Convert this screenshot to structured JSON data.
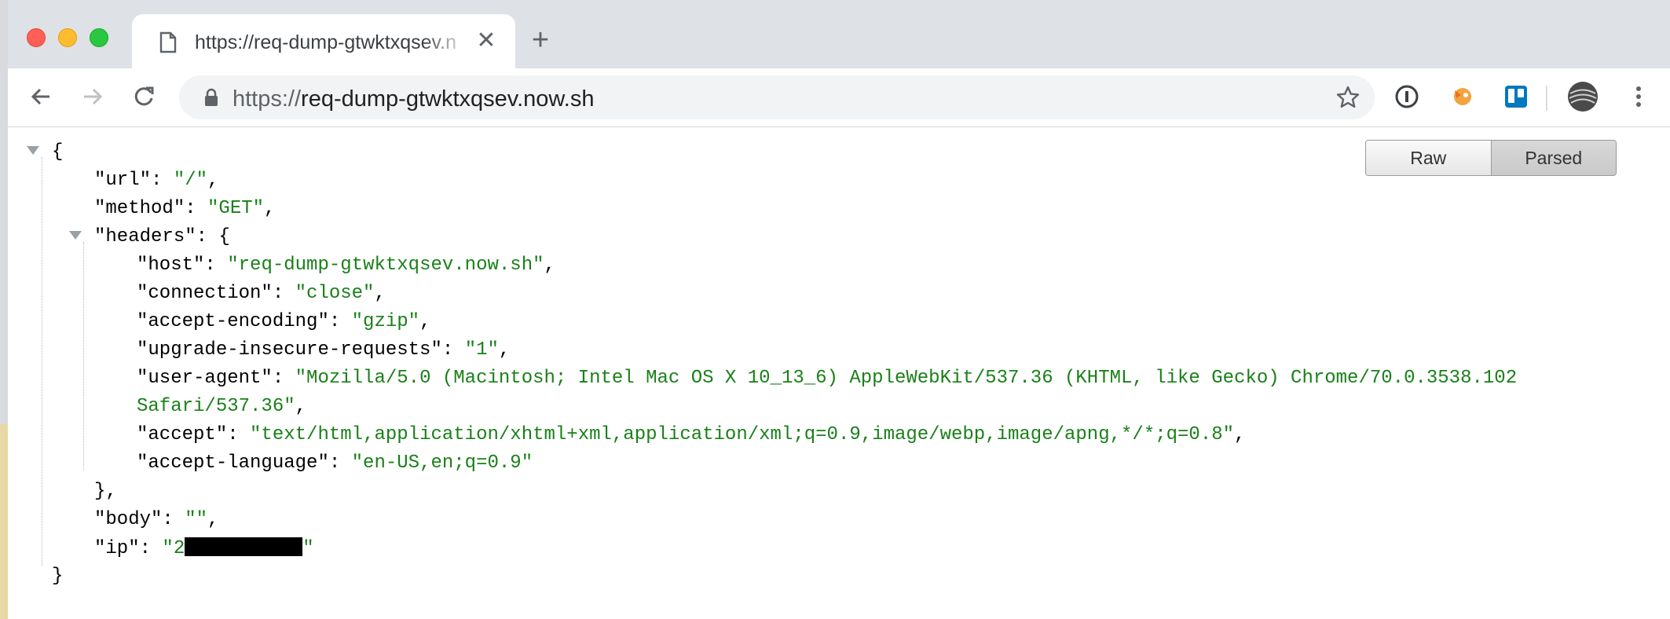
{
  "window": {
    "tab_title": "https://req-dump-gtwktxqsev.n",
    "new_tab_label": "+",
    "close_tab_label": "✕"
  },
  "toolbar": {
    "url_scheme": "https://",
    "url_host": "req-dump-gtwktxqsev.now.sh"
  },
  "viewer": {
    "raw_label": "Raw",
    "parsed_label": "Parsed",
    "active": "Parsed"
  },
  "json": {
    "open_brace": "{",
    "close_brace": "}",
    "url": {
      "key": "\"url\"",
      "value": "\"/\""
    },
    "method": {
      "key": "\"method\"",
      "value": "\"GET\""
    },
    "headers": {
      "key": "\"headers\"",
      "open": "{",
      "close": "},",
      "host": {
        "key": "\"host\"",
        "value": "\"req-dump-gtwktxqsev.now.sh\""
      },
      "connection": {
        "key": "\"connection\"",
        "value": "\"close\""
      },
      "accept_encoding": {
        "key": "\"accept-encoding\"",
        "value": "\"gzip\""
      },
      "upgrade_insecure_requests": {
        "key": "\"upgrade-insecure-requests\"",
        "value": "\"1\""
      },
      "user_agent": {
        "key": "\"user-agent\"",
        "value_line1": "\"Mozilla/5.0 (Macintosh; Intel Mac OS X 10_13_6) AppleWebKit/537.36 (KHTML, like Gecko) Chrome/70.0.3538.102",
        "value_line2": "Safari/537.36\""
      },
      "accept": {
        "key": "\"accept\"",
        "value": "\"text/html,application/xhtml+xml,application/xml;q=0.9,image/webp,image/apng,*/*;q=0.8\""
      },
      "accept_language": {
        "key": "\"accept-language\"",
        "value": "\"en-US,en;q=0.9\""
      }
    },
    "body": {
      "key": "\"body\"",
      "value": "\"\""
    },
    "ip": {
      "key": "\"ip\"",
      "value_start": "\"2",
      "value_end": "\""
    }
  },
  "colors": {
    "string": "#1a8019",
    "key": "#000000",
    "chrome_tabbar": "#dee1e6",
    "close_red": "#ff5f57",
    "minimize_yellow": "#febc2e",
    "maximize_green": "#28c840"
  },
  "icons": [
    "close-window",
    "minimize-window",
    "maximize-window",
    "page-icon",
    "back-arrow-icon",
    "forward-arrow-icon",
    "reload-icon",
    "lock-icon",
    "star-icon",
    "password-manager-icon",
    "extension-fox-icon",
    "trello-icon",
    "profile-avatar-icon",
    "menu-dots-icon"
  ]
}
